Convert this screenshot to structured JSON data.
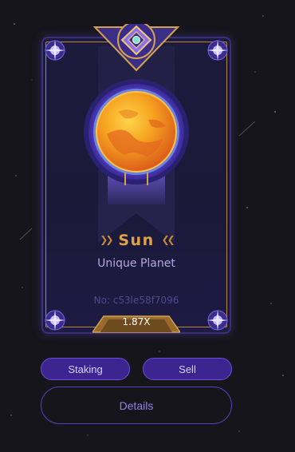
{
  "card": {
    "name": "Sun",
    "rarity": "Unique Planet",
    "token_id": "No: c53le58f7096",
    "multiplier": "1.87X"
  },
  "actions": {
    "staking_label": "Staking",
    "sell_label": "Sell",
    "details_label": "Details"
  },
  "icons": {
    "emblem": "diamond-gem-emblem-icon",
    "corners": "star-orb-icon",
    "name_decoration": "double-chevron-icon"
  },
  "colors": {
    "background": "#16151b",
    "card_border": "#b6873b",
    "name": "#e0a34a",
    "button_fill": "#3c2491",
    "button_border": "#6c4ed8",
    "details_text": "#9280e8"
  }
}
